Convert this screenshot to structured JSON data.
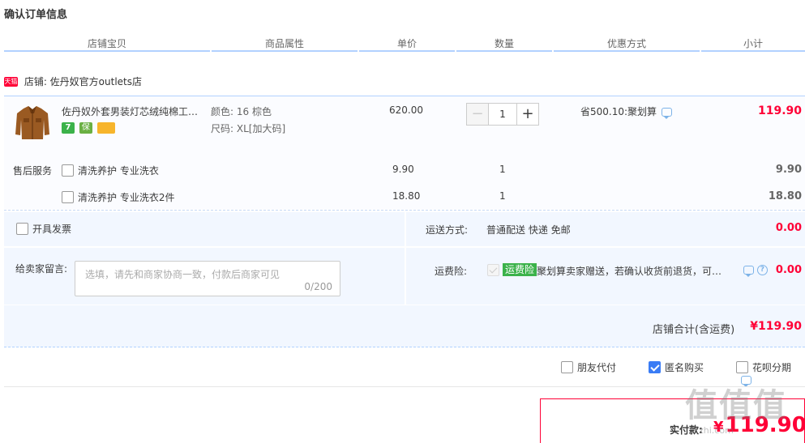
{
  "page": {
    "title": "确认订单信息"
  },
  "columns": [
    "店铺宝贝",
    "商品属性",
    "单价",
    "数量",
    "优惠方式",
    "小计"
  ],
  "shop": {
    "badge": "天猫",
    "name": "店铺: 佐丹奴官方outlets店"
  },
  "product": {
    "title": "佐丹奴外套男装灯芯绒纯棉工装夹克",
    "badges": [
      "7",
      "保"
    ],
    "color": "颜色: 16 棕色",
    "size": "尺码: XL[加大码]",
    "price": "620.00",
    "quantity": "1",
    "discount": "省500.10:聚划算",
    "subtotal": "119.90"
  },
  "services": {
    "label": "售后服务",
    "items": [
      {
        "name": "清洗养护 专业洗衣",
        "price": "9.90",
        "qty": "1",
        "subtotal": "9.90"
      },
      {
        "name": "清洗养护 专业洗衣2件",
        "price": "18.80",
        "qty": "1",
        "subtotal": "18.80"
      }
    ]
  },
  "invoice": {
    "label": "开具发票"
  },
  "shipping": {
    "label": "运送方式:",
    "value": "普通配送 快递 免邮",
    "cost": "0.00"
  },
  "message": {
    "label": "给卖家留言:",
    "placeholder": "选填，请先和商家协商一致，付款后商家可见",
    "count": "0/200"
  },
  "insurance": {
    "label": "运费险:",
    "tag": "运费险",
    "desc": "聚划算卖家赠送，若确认收货前退货，可获保险赔付",
    "cost": "0.00"
  },
  "total": {
    "label": "店铺合计(含运费)",
    "value": "¥119.90"
  },
  "options": {
    "friend_pay": "朋友代付",
    "anonymous": "匿名购买",
    "huabei": "花呗分期"
  },
  "pay": {
    "label": "实付款:",
    "currency": "¥",
    "value": "119.90"
  },
  "watermark": {
    "main": "值值值",
    "sub": "zhi.com"
  },
  "colors": {
    "accent": "#ff0036",
    "panel": "#f2f7ff",
    "border": "#b2d1ff",
    "checked": "#3a7cf5"
  }
}
